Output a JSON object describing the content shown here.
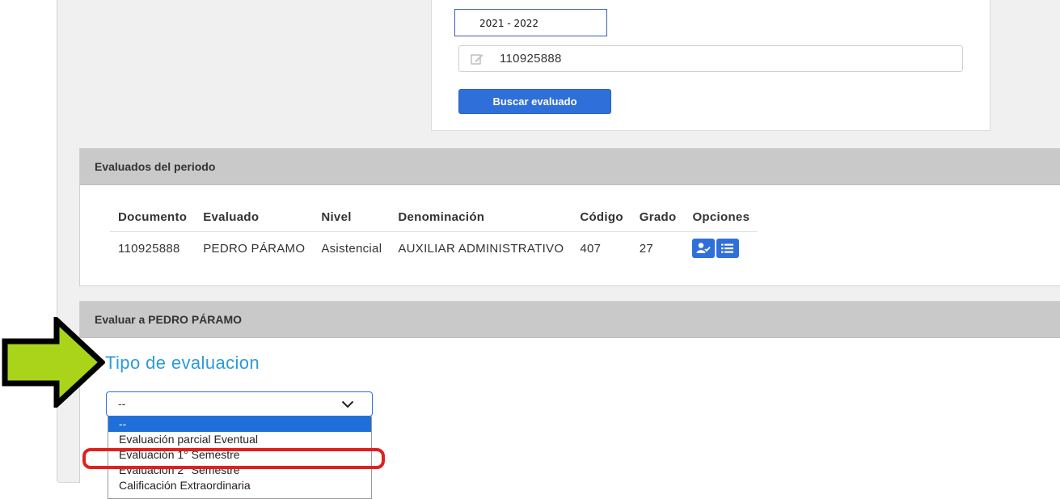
{
  "search": {
    "period_value": "2021 - 2022",
    "document_value": "110925888",
    "search_button_label": "Buscar evaluado"
  },
  "evaluados": {
    "title": "Evaluados del periodo",
    "columns": [
      "Documento",
      "Evaluado",
      "Nivel",
      "Denominación",
      "Código",
      "Grado",
      "Opciones"
    ],
    "rows": [
      [
        "110925888",
        "PEDRO PÁRAMO",
        "Asistencial",
        "AUXILIAR ADMINISTRATIVO",
        "407",
        "27"
      ]
    ],
    "option_icons": [
      "user-check-icon",
      "list-icon"
    ]
  },
  "evaluar": {
    "title": "Evaluar a PEDRO PÁRAMO",
    "heading": "Tipo de evaluacion",
    "select_value": "--",
    "options": [
      "--",
      "Evaluación parcial Eventual",
      "Evaluación 1° Semestre",
      "Evaluación 2° Semestre",
      "Calificación Extraordinaria"
    ],
    "highlighted_option": "Evaluación 1° Semestre"
  },
  "colors": {
    "accent_blue": "#2f6fd9",
    "heading_blue": "#2d9bd8",
    "arrow_green": "#a9d41a",
    "highlight_red": "#e02020"
  }
}
